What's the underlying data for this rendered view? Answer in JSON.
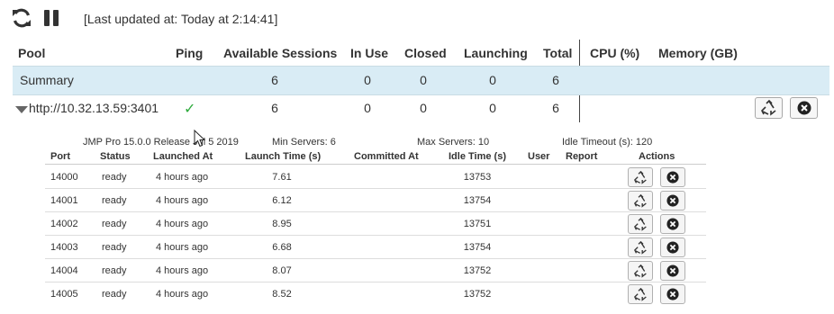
{
  "toolbar": {
    "refresh_icon": "refresh-icon",
    "pause_icon": "pause-icon",
    "last_updated": "[Last updated at: Today at 2:14:41]"
  },
  "table": {
    "headers": {
      "pool": "Pool",
      "ping": "Ping",
      "available": "Available Sessions",
      "in_use": "In Use",
      "closed": "Closed",
      "launching": "Launching",
      "total": "Total",
      "cpu": "CPU (%)",
      "memory": "Memory (GB)"
    },
    "summary": {
      "label": "Summary",
      "available": "6",
      "in_use": "0",
      "closed": "0",
      "launching": "0",
      "total": "6"
    },
    "pool_row": {
      "url": "http://10.32.13.59:3401",
      "ping": "✓",
      "available": "6",
      "in_use": "0",
      "closed": "0",
      "launching": "0",
      "total": "6"
    }
  },
  "detail": {
    "info": {
      "version": "JMP Pro 15.0.0 Release Jul 5 2019",
      "min_servers": "Min Servers: 6",
      "max_servers": "Max Servers: 10",
      "idle_timeout": "Idle Timeout (s): 120"
    },
    "headers": {
      "port": "Port",
      "status": "Status",
      "launched_at": "Launched At",
      "launch_time": "Launch Time (s)",
      "committed_at": "Committed At",
      "idle_time": "Idle Time (s)",
      "user": "User",
      "report": "Report",
      "actions": "Actions"
    },
    "rows": [
      {
        "port": "14000",
        "status": "ready",
        "launched_at": "4 hours ago",
        "launch_time": "7.61",
        "committed_at": "",
        "idle_time": "13753",
        "user": "",
        "report": ""
      },
      {
        "port": "14001",
        "status": "ready",
        "launched_at": "4 hours ago",
        "launch_time": "6.12",
        "committed_at": "",
        "idle_time": "13754",
        "user": "",
        "report": ""
      },
      {
        "port": "14002",
        "status": "ready",
        "launched_at": "4 hours ago",
        "launch_time": "8.95",
        "committed_at": "",
        "idle_time": "13751",
        "user": "",
        "report": ""
      },
      {
        "port": "14003",
        "status": "ready",
        "launched_at": "4 hours ago",
        "launch_time": "6.68",
        "committed_at": "",
        "idle_time": "13754",
        "user": "",
        "report": ""
      },
      {
        "port": "14004",
        "status": "ready",
        "launched_at": "4 hours ago",
        "launch_time": "8.07",
        "committed_at": "",
        "idle_time": "13752",
        "user": "",
        "report": ""
      },
      {
        "port": "14005",
        "status": "ready",
        "launched_at": "4 hours ago",
        "launch_time": "8.52",
        "committed_at": "",
        "idle_time": "13752",
        "user": "",
        "report": ""
      }
    ]
  },
  "colors": {
    "summary_band": "#d9ecf5",
    "ping_ok": "#2eaa3c"
  },
  "icons": {
    "recycle": "recycle-icon",
    "close": "close-circle-icon",
    "expand": "triangle-down-icon"
  }
}
